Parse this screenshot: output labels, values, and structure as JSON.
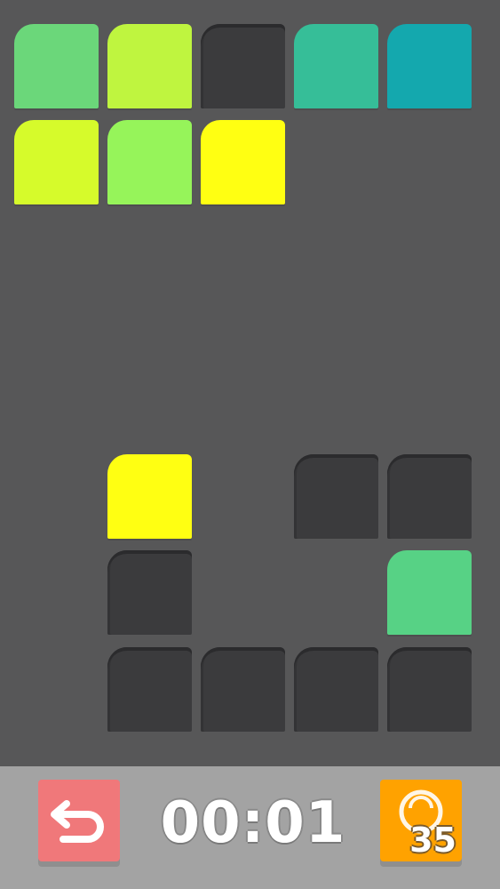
{
  "palette": {
    "row1": [
      "#6bd77a",
      "#bff53f",
      null,
      "#36be98",
      "#14a8ae"
    ],
    "row2": [
      "#d6fb2b",
      "#96f45a",
      "#ffff12"
    ]
  },
  "board": {
    "row1": [
      {
        "color": "#6bd77a"
      },
      {
        "color": "#bff53f"
      },
      {
        "color": null
      },
      {
        "color": "#36be98"
      },
      {
        "color": "#14a8ae"
      }
    ],
    "row2": [
      {
        "color": "#d6fb2b"
      },
      {
        "color": "#96f45a"
      },
      {
        "color": "#ffff12"
      }
    ],
    "puzzle": {
      "row1": [
        {
          "color": "#ffff12"
        },
        {
          "color": null
        },
        {
          "color": null
        }
      ],
      "row2": [
        {
          "color": null
        },
        {
          "color": "#57d285"
        }
      ],
      "row3": [
        {
          "color": null
        },
        {
          "color": null
        },
        {
          "color": null
        },
        {
          "color": null
        }
      ]
    }
  },
  "controls": {
    "undo_icon": "undo-arrow-icon",
    "undo_color": "#f0787a",
    "timer": "00:01",
    "hint_icon": "hint-bulb-icon",
    "hint_color": "#ffa200",
    "hint_count": "35"
  }
}
